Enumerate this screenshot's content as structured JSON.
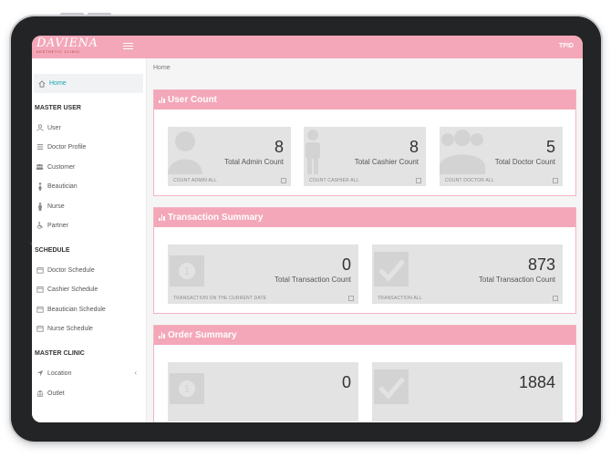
{
  "brand": {
    "logo_text": "DAVIENA",
    "logo_sub": "AESTHETIC CLINIC"
  },
  "header": {
    "user": "TPID"
  },
  "breadcrumb": "Home",
  "sidebar": {
    "home": "Home",
    "master_user": {
      "title": "MASTER USER",
      "items": [
        "User",
        "Doctor Profile",
        "Customer",
        "Beautician",
        "Nurse",
        "Partner"
      ]
    },
    "schedule": {
      "title": "SCHEDULE",
      "items": [
        "Doctor Schedule",
        "Cashier Schedule",
        "Beautician Schedule",
        "Nurse Schedule"
      ]
    },
    "master_clinic": {
      "title": "MASTER CLINIC",
      "items": [
        "Location",
        "Outlet"
      ]
    }
  },
  "user_count": {
    "title": "User Count",
    "cards": [
      {
        "value": "8",
        "label": "Total Admin Count",
        "footer": "COUNT ADMIN ALL",
        "icon": "user-icon"
      },
      {
        "value": "8",
        "label": "Total Cashier Count",
        "footer": "COUNT CASHIER ALL",
        "icon": "male-icon"
      },
      {
        "value": "5",
        "label": "Total Doctor Count",
        "footer": "COUNT DOCTOR ALL",
        "icon": "users-icon"
      }
    ]
  },
  "transaction_summary": {
    "title": "Transaction Summary",
    "cards": [
      {
        "value": "0",
        "label": "Total Transaction Count",
        "footer": "TRANSACTION ON THE CURRENT DATE",
        "icon": "money-icon"
      },
      {
        "value": "873",
        "label": "Total Transaction Count",
        "footer": "TRANSACTION ALL",
        "icon": "check-icon"
      }
    ]
  },
  "order_summary": {
    "title": "Order Summary",
    "cards": [
      {
        "value": "0",
        "label": "",
        "footer": "",
        "icon": "money-icon"
      },
      {
        "value": "1884",
        "label": "",
        "footer": "",
        "icon": "check-icon"
      }
    ]
  }
}
